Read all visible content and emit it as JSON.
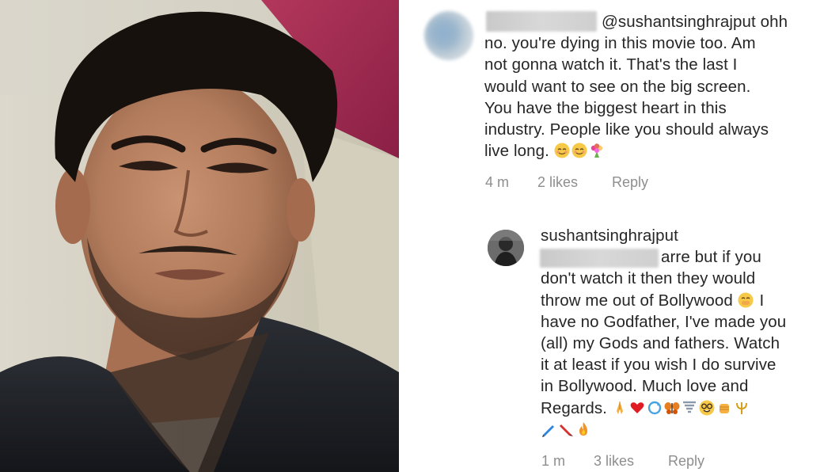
{
  "comment1": {
    "mention": "@sushantsinghrajput",
    "line1_rest": " ohh",
    "lines": [
      "no. you're dying in this movie too. Am",
      "not gonna watch it. That's the last I",
      "would want to see on the big screen.",
      "You have the biggest heart in this",
      "industry. People like you should always"
    ],
    "last_line": "live long.",
    "emojis": [
      "blush-emoji",
      "blush-emoji",
      "bouquet-emoji"
    ],
    "time": "4 m",
    "likes": "2 likes",
    "reply": "Reply"
  },
  "comment2": {
    "username": "sushantsinghrajput",
    "line1_rest": "arre but if you",
    "lines_a": [
      "don't watch it then they would"
    ],
    "line_bollywood": "throw me out of Bollywood",
    "line_bollywood_tail": "I",
    "lines_b": [
      "have no Godfather, I've made you",
      "(all) my Gods and fathers. Watch",
      "it at least if you wish I do survive",
      "in Bollywood. Much love and"
    ],
    "regards": "Regards.",
    "emojis_row1": [
      "folded-hands-emoji",
      "red-heart-emoji",
      "arrows-cycle-emoji",
      "butterfly-emoji",
      "tornado-emoji",
      "nerd-face-emoji",
      "raised-fist-emoji",
      "trident-emoji"
    ],
    "emojis_row2": [
      "pen-emoji",
      "crayon-emoji",
      "fire-emoji"
    ],
    "time": "1 m",
    "likes": "3 likes",
    "reply": "Reply"
  },
  "colors": {
    "text": "#262626",
    "meta": "#8e8e8e",
    "mention": "#003569"
  }
}
